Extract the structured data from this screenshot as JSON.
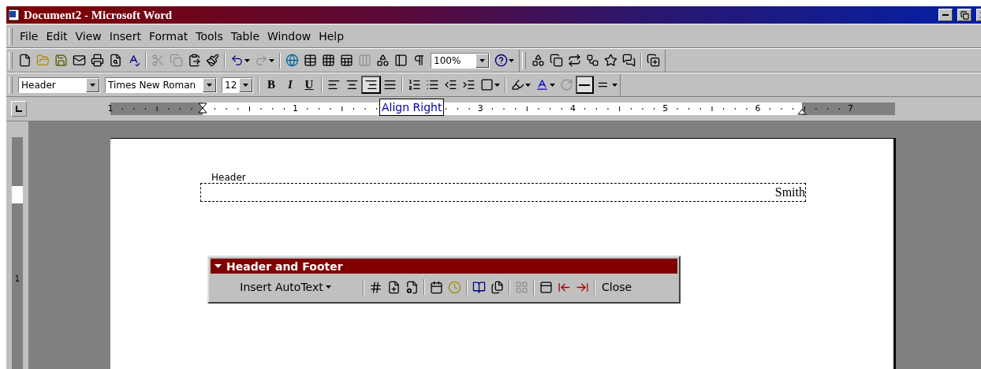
{
  "window": {
    "title": "Document2 - Microsoft Word"
  },
  "menu": [
    "File",
    "Edit",
    "View",
    "Insert",
    "Format",
    "Tools",
    "Table",
    "Window",
    "Help"
  ],
  "standard_toolbar": {
    "groups": [
      [
        {
          "kind": "new",
          "disabled": false
        },
        {
          "kind": "open",
          "disabled": false
        },
        {
          "kind": "save",
          "disabled": false
        },
        {
          "kind": "email",
          "disabled": false
        },
        {
          "kind": "print",
          "disabled": false
        },
        {
          "kind": "preview",
          "disabled": false
        },
        {
          "kind": "spelling",
          "disabled": false
        }
      ],
      [
        {
          "kind": "cut",
          "disabled": true
        },
        {
          "kind": "copy",
          "disabled": true
        },
        {
          "kind": "paste",
          "disabled": false
        },
        {
          "kind": "painter",
          "disabled": false
        }
      ],
      [
        {
          "kind": "undo",
          "disabled": false
        },
        {
          "kind": "redo",
          "disabled": true
        }
      ],
      [
        {
          "kind": "hyperlink",
          "disabled": false
        },
        {
          "kind": "tables",
          "disabled": false
        },
        {
          "kind": "table",
          "disabled": false
        },
        {
          "kind": "sheet",
          "disabled": false
        },
        {
          "kind": "columns",
          "disabled": true
        },
        {
          "kind": "drawing",
          "disabled": false
        },
        {
          "kind": "map",
          "disabled": false
        },
        {
          "kind": "pilcrow",
          "disabled": false
        }
      ]
    ],
    "zoom": "100%"
  },
  "drawing_toolbar": {
    "groups": [
      [
        {
          "kind": "shapes"
        },
        {
          "kind": "duplicate"
        },
        {
          "kind": "swap"
        },
        {
          "kind": "flow"
        },
        {
          "kind": "star"
        },
        {
          "kind": "callout"
        }
      ],
      [
        {
          "kind": "addcopy"
        }
      ]
    ]
  },
  "formatting_toolbar": {
    "style": "Header",
    "font": "Times New Roman",
    "size": "12",
    "text_buttons": [
      {
        "kind": "bold",
        "label": "B",
        "selected": false
      },
      {
        "kind": "italic",
        "label": "I",
        "selected": false
      },
      {
        "kind": "underline",
        "label": "U",
        "selected": false
      }
    ],
    "alignment": [
      {
        "kind": "left",
        "selected": false
      },
      {
        "kind": "center",
        "selected": false
      },
      {
        "kind": "right",
        "selected": true
      },
      {
        "kind": "justify",
        "selected": false
      }
    ],
    "lists": [
      {
        "kind": "numbering"
      },
      {
        "kind": "bullets"
      },
      {
        "kind": "outdent"
      },
      {
        "kind": "indent"
      },
      {
        "kind": "borders"
      }
    ],
    "extras": [
      {
        "kind": "highlight",
        "selected": false,
        "disabled": false
      },
      {
        "kind": "fontcolor",
        "selected": false,
        "disabled": false
      },
      {
        "kind": "rotate",
        "selected": false,
        "disabled": true
      },
      {
        "kind": "single",
        "selected": true,
        "disabled": false
      },
      {
        "kind": "double",
        "selected": false,
        "disabled": false
      }
    ]
  },
  "ruler": {
    "numbers": [
      "1",
      "1",
      "3",
      "4",
      "5",
      "6",
      "7"
    ],
    "tooltip": "Align Right",
    "vertical_number": "1"
  },
  "document": {
    "header_label": "Header",
    "header_text": "Smith"
  },
  "header_footer_toolbar": {
    "title": "Header and Footer",
    "autotext": "Insert AutoText",
    "groups": [
      [
        {
          "kind": "pagenumber",
          "disabled": false
        },
        {
          "kind": "pagecount",
          "disabled": false
        },
        {
          "kind": "pageformat",
          "disabled": false
        }
      ],
      [
        {
          "kind": "date",
          "disabled": false
        },
        {
          "kind": "time",
          "disabled": false
        }
      ],
      [
        {
          "kind": "setup",
          "disabled": false
        },
        {
          "kind": "showhide",
          "disabled": false
        }
      ],
      [
        {
          "kind": "sameprevious",
          "disabled": true
        }
      ],
      [
        {
          "kind": "switch",
          "disabled": false
        },
        {
          "kind": "previous",
          "disabled": false
        },
        {
          "kind": "next",
          "disabled": false
        }
      ]
    ],
    "close": "Close"
  }
}
